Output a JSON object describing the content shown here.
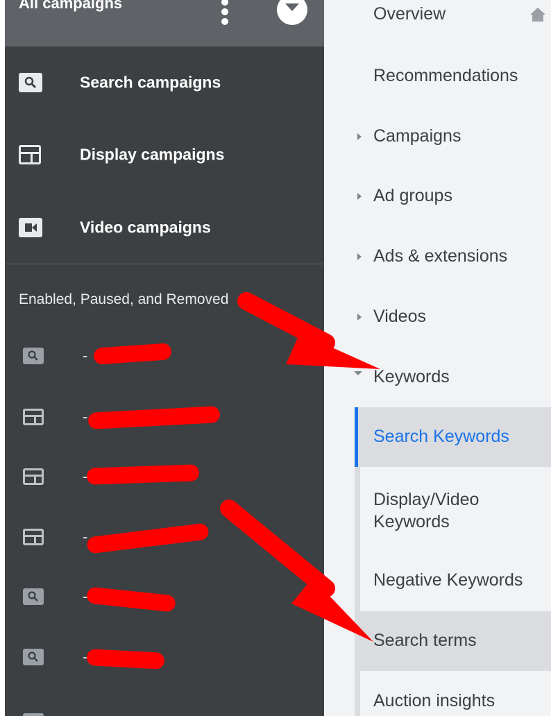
{
  "left_panel": {
    "header_title": "All campaigns",
    "campaign_types": [
      {
        "icon": "search-icon",
        "label": "Search campaigns"
      },
      {
        "icon": "display-icon",
        "label": "Display campaigns"
      },
      {
        "icon": "video-icon",
        "label": "Video campaigns"
      }
    ],
    "filter_label": "Enabled, Paused, and Removed",
    "campaigns": [
      {
        "icon": "search-icon",
        "name": "-"
      },
      {
        "icon": "display-icon",
        "name": "-"
      },
      {
        "icon": "display-icon",
        "name": "-"
      },
      {
        "icon": "display-icon",
        "name": "-"
      },
      {
        "icon": "search-icon",
        "name": "-"
      },
      {
        "icon": "search-icon",
        "name": "-"
      }
    ]
  },
  "right_panel": {
    "nav": [
      {
        "label": "Overview"
      },
      {
        "label": "Recommendations"
      },
      {
        "label": "Campaigns"
      },
      {
        "label": "Ad groups"
      },
      {
        "label": "Ads & extensions"
      },
      {
        "label": "Videos"
      },
      {
        "label": "Keywords"
      }
    ],
    "keywords_sub": [
      {
        "label": "Search Keywords",
        "active": true
      },
      {
        "label": "Display/Video Keywords"
      },
      {
        "label": "Negative Keywords"
      },
      {
        "label": "Search terms"
      },
      {
        "label": "Auction insights"
      }
    ]
  },
  "colors": {
    "left_bg": "#3c4043",
    "header_bg": "#5f6368",
    "right_bg": "#f1f3f4",
    "active_blue": "#1a73e8",
    "annotation_red": "#ff0000"
  }
}
